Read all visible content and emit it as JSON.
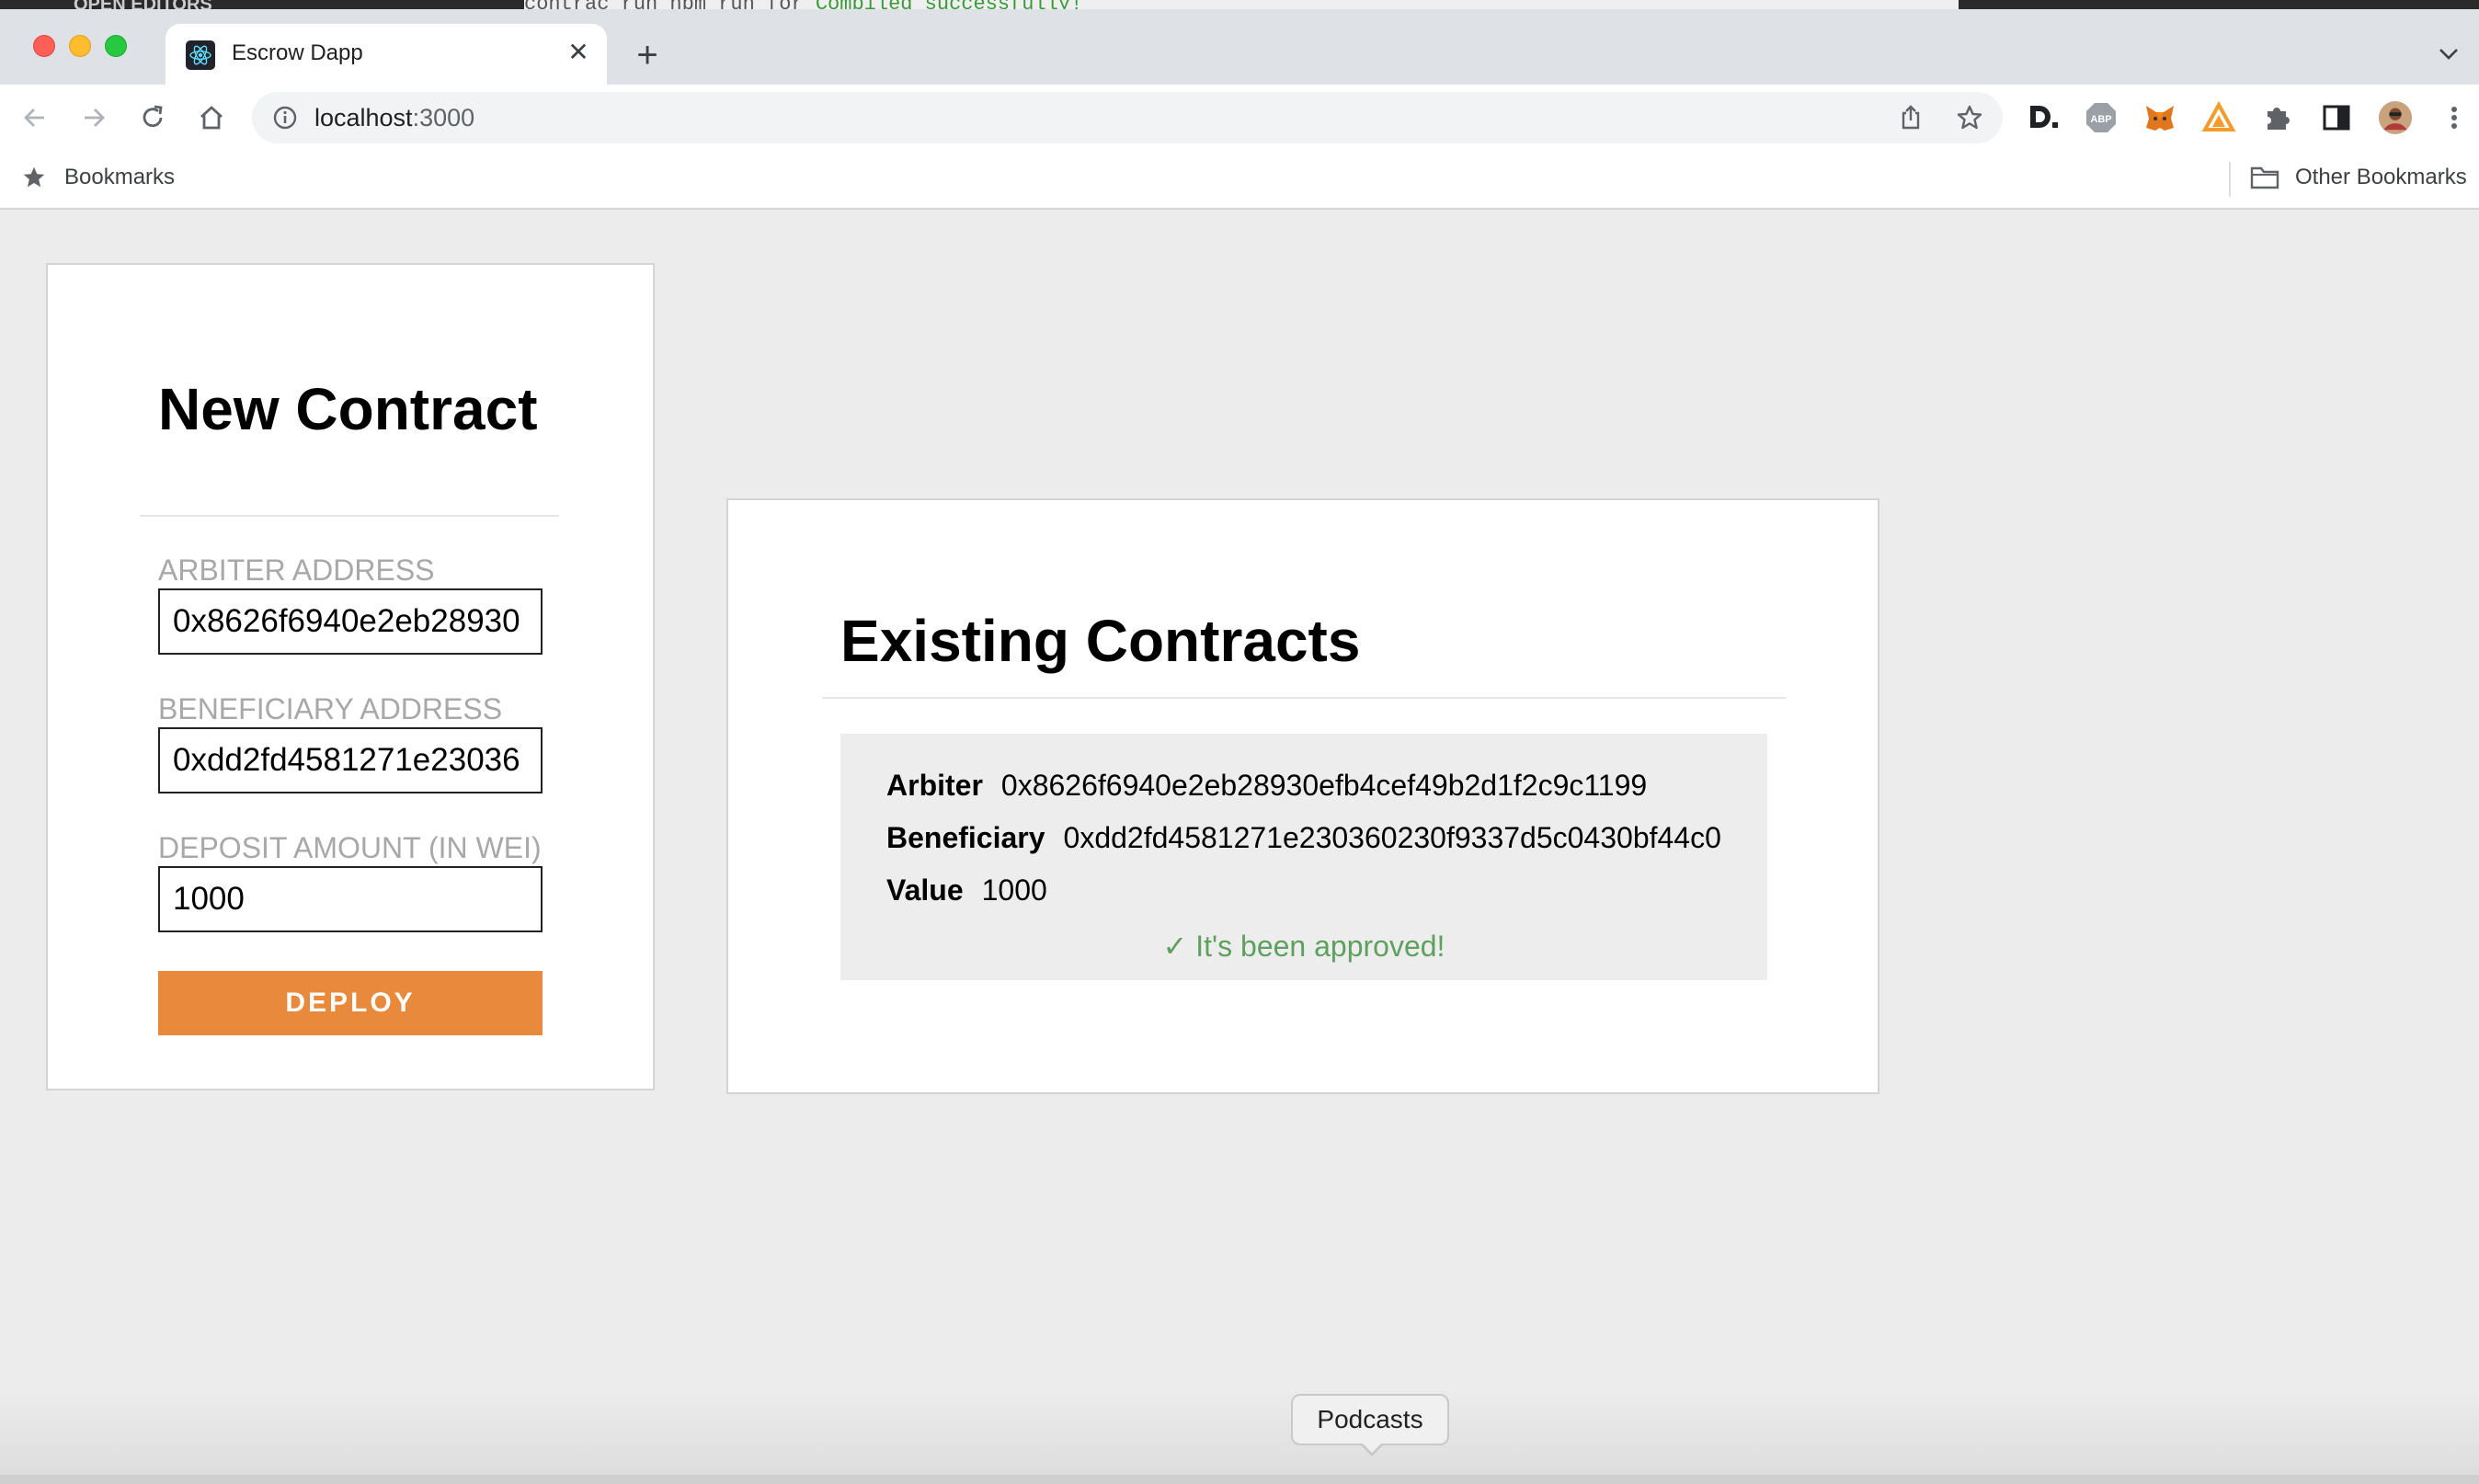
{
  "background_editor": {
    "left_text": "OPEN EDITORS",
    "terminal_prefix": "contrac   run  npm run  ",
    "terminal_partial": "for",
    "terminal_status": "Compiled successfully!"
  },
  "browser": {
    "tab": {
      "title": "Escrow Dapp",
      "favicon": "react-icon"
    },
    "address": {
      "host": "localhost",
      "port": ":3000"
    },
    "bookmarks_bar": {
      "left_label": "Bookmarks",
      "right_label": "Other Bookmarks"
    }
  },
  "new_contract": {
    "title": "New Contract",
    "arbiter_label": "ARBITER ADDRESS",
    "arbiter_value": "0x8626f6940e2eb28930",
    "beneficiary_label": "BENEFICIARY ADDRESS",
    "beneficiary_value": "0xdd2fd4581271e23036",
    "deposit_label": "DEPOSIT AMOUNT (IN WEI)",
    "deposit_value": "1000",
    "deploy_label": "DEPLOY"
  },
  "existing_contracts": {
    "title": "Existing Contracts",
    "items": [
      {
        "arbiter_label": "Arbiter",
        "arbiter": "0x8626f6940e2eb28930efb4cef49b2d1f2c9c1199",
        "beneficiary_label": "Beneficiary",
        "beneficiary": "0xdd2fd4581271e230360230f9337d5c0430bf44c0",
        "value_label": "Value",
        "value": "1000",
        "status": "✓ It's been approved!"
      }
    ]
  },
  "dock": {
    "tooltip": "Podcasts"
  },
  "colors": {
    "deploy": "#e8893b",
    "approved": "#5ea05e",
    "page_bg": "#ececec"
  }
}
